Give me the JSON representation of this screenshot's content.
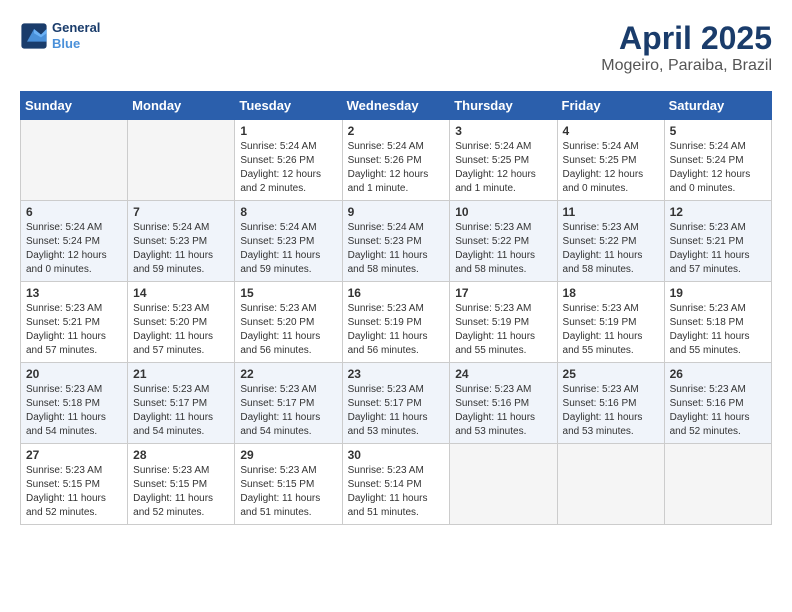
{
  "logo": {
    "line1": "General",
    "line2": "Blue"
  },
  "title": "April 2025",
  "subtitle": "Mogeiro, Paraiba, Brazil",
  "weekdays": [
    "Sunday",
    "Monday",
    "Tuesday",
    "Wednesday",
    "Thursday",
    "Friday",
    "Saturday"
  ],
  "weeks": [
    [
      {
        "day": "",
        "empty": true
      },
      {
        "day": "",
        "empty": true
      },
      {
        "day": "1",
        "sunrise": "Sunrise: 5:24 AM",
        "sunset": "Sunset: 5:26 PM",
        "daylight": "Daylight: 12 hours and 2 minutes."
      },
      {
        "day": "2",
        "sunrise": "Sunrise: 5:24 AM",
        "sunset": "Sunset: 5:26 PM",
        "daylight": "Daylight: 12 hours and 1 minute."
      },
      {
        "day": "3",
        "sunrise": "Sunrise: 5:24 AM",
        "sunset": "Sunset: 5:25 PM",
        "daylight": "Daylight: 12 hours and 1 minute."
      },
      {
        "day": "4",
        "sunrise": "Sunrise: 5:24 AM",
        "sunset": "Sunset: 5:25 PM",
        "daylight": "Daylight: 12 hours and 0 minutes."
      },
      {
        "day": "5",
        "sunrise": "Sunrise: 5:24 AM",
        "sunset": "Sunset: 5:24 PM",
        "daylight": "Daylight: 12 hours and 0 minutes."
      }
    ],
    [
      {
        "day": "6",
        "sunrise": "Sunrise: 5:24 AM",
        "sunset": "Sunset: 5:24 PM",
        "daylight": "Daylight: 12 hours and 0 minutes."
      },
      {
        "day": "7",
        "sunrise": "Sunrise: 5:24 AM",
        "sunset": "Sunset: 5:23 PM",
        "daylight": "Daylight: 11 hours and 59 minutes."
      },
      {
        "day": "8",
        "sunrise": "Sunrise: 5:24 AM",
        "sunset": "Sunset: 5:23 PM",
        "daylight": "Daylight: 11 hours and 59 minutes."
      },
      {
        "day": "9",
        "sunrise": "Sunrise: 5:24 AM",
        "sunset": "Sunset: 5:23 PM",
        "daylight": "Daylight: 11 hours and 58 minutes."
      },
      {
        "day": "10",
        "sunrise": "Sunrise: 5:23 AM",
        "sunset": "Sunset: 5:22 PM",
        "daylight": "Daylight: 11 hours and 58 minutes."
      },
      {
        "day": "11",
        "sunrise": "Sunrise: 5:23 AM",
        "sunset": "Sunset: 5:22 PM",
        "daylight": "Daylight: 11 hours and 58 minutes."
      },
      {
        "day": "12",
        "sunrise": "Sunrise: 5:23 AM",
        "sunset": "Sunset: 5:21 PM",
        "daylight": "Daylight: 11 hours and 57 minutes."
      }
    ],
    [
      {
        "day": "13",
        "sunrise": "Sunrise: 5:23 AM",
        "sunset": "Sunset: 5:21 PM",
        "daylight": "Daylight: 11 hours and 57 minutes."
      },
      {
        "day": "14",
        "sunrise": "Sunrise: 5:23 AM",
        "sunset": "Sunset: 5:20 PM",
        "daylight": "Daylight: 11 hours and 57 minutes."
      },
      {
        "day": "15",
        "sunrise": "Sunrise: 5:23 AM",
        "sunset": "Sunset: 5:20 PM",
        "daylight": "Daylight: 11 hours and 56 minutes."
      },
      {
        "day": "16",
        "sunrise": "Sunrise: 5:23 AM",
        "sunset": "Sunset: 5:19 PM",
        "daylight": "Daylight: 11 hours and 56 minutes."
      },
      {
        "day": "17",
        "sunrise": "Sunrise: 5:23 AM",
        "sunset": "Sunset: 5:19 PM",
        "daylight": "Daylight: 11 hours and 55 minutes."
      },
      {
        "day": "18",
        "sunrise": "Sunrise: 5:23 AM",
        "sunset": "Sunset: 5:19 PM",
        "daylight": "Daylight: 11 hours and 55 minutes."
      },
      {
        "day": "19",
        "sunrise": "Sunrise: 5:23 AM",
        "sunset": "Sunset: 5:18 PM",
        "daylight": "Daylight: 11 hours and 55 minutes."
      }
    ],
    [
      {
        "day": "20",
        "sunrise": "Sunrise: 5:23 AM",
        "sunset": "Sunset: 5:18 PM",
        "daylight": "Daylight: 11 hours and 54 minutes."
      },
      {
        "day": "21",
        "sunrise": "Sunrise: 5:23 AM",
        "sunset": "Sunset: 5:17 PM",
        "daylight": "Daylight: 11 hours and 54 minutes."
      },
      {
        "day": "22",
        "sunrise": "Sunrise: 5:23 AM",
        "sunset": "Sunset: 5:17 PM",
        "daylight": "Daylight: 11 hours and 54 minutes."
      },
      {
        "day": "23",
        "sunrise": "Sunrise: 5:23 AM",
        "sunset": "Sunset: 5:17 PM",
        "daylight": "Daylight: 11 hours and 53 minutes."
      },
      {
        "day": "24",
        "sunrise": "Sunrise: 5:23 AM",
        "sunset": "Sunset: 5:16 PM",
        "daylight": "Daylight: 11 hours and 53 minutes."
      },
      {
        "day": "25",
        "sunrise": "Sunrise: 5:23 AM",
        "sunset": "Sunset: 5:16 PM",
        "daylight": "Daylight: 11 hours and 53 minutes."
      },
      {
        "day": "26",
        "sunrise": "Sunrise: 5:23 AM",
        "sunset": "Sunset: 5:16 PM",
        "daylight": "Daylight: 11 hours and 52 minutes."
      }
    ],
    [
      {
        "day": "27",
        "sunrise": "Sunrise: 5:23 AM",
        "sunset": "Sunset: 5:15 PM",
        "daylight": "Daylight: 11 hours and 52 minutes."
      },
      {
        "day": "28",
        "sunrise": "Sunrise: 5:23 AM",
        "sunset": "Sunset: 5:15 PM",
        "daylight": "Daylight: 11 hours and 52 minutes."
      },
      {
        "day": "29",
        "sunrise": "Sunrise: 5:23 AM",
        "sunset": "Sunset: 5:15 PM",
        "daylight": "Daylight: 11 hours and 51 minutes."
      },
      {
        "day": "30",
        "sunrise": "Sunrise: 5:23 AM",
        "sunset": "Sunset: 5:14 PM",
        "daylight": "Daylight: 11 hours and 51 minutes."
      },
      {
        "day": "",
        "empty": true
      },
      {
        "day": "",
        "empty": true
      },
      {
        "day": "",
        "empty": true
      }
    ]
  ]
}
